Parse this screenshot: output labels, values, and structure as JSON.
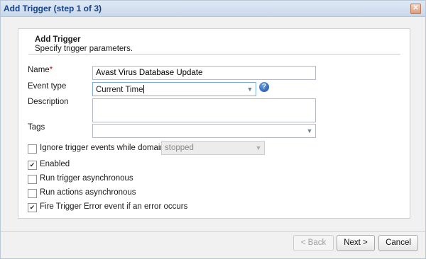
{
  "dialog": {
    "title": "Add Trigger (step 1 of 3)",
    "close_glyph": "✕"
  },
  "section": {
    "title": "Add Trigger",
    "subtitle": "Specify trigger parameters."
  },
  "form": {
    "name_label": "Name",
    "name_required_mark": "*",
    "name_value": "Avast Virus Database Update",
    "event_type_label": "Event type",
    "event_type_value": "Current Time",
    "help_glyph": "?",
    "description_label": "Description",
    "description_value": "",
    "tags_label": "Tags",
    "tags_value": "",
    "ignore_label": "Ignore trigger events while domain is",
    "ignore_checked": false,
    "domain_state_value": "stopped",
    "enabled_label": "Enabled",
    "enabled_checked": true,
    "run_trigger_async_label": "Run trigger asynchronous",
    "run_trigger_async_checked": false,
    "run_actions_async_label": "Run actions asynchronous",
    "run_actions_async_checked": false,
    "fire_error_label": "Fire Trigger Error event if an error occurs",
    "fire_error_checked": true,
    "check_glyph": "✔",
    "dropdown_glyph": "▼"
  },
  "buttons": {
    "back": "< Back",
    "next": "Next >",
    "cancel": "Cancel"
  }
}
